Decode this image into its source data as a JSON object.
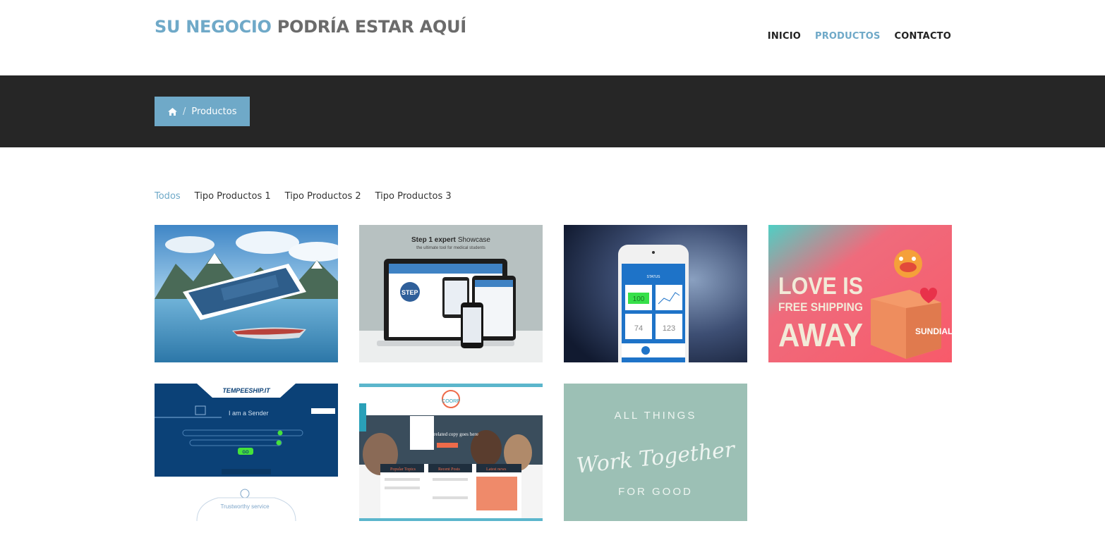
{
  "header": {
    "logo_accent": "SU NEGOCIO",
    "logo_rest": "PODRÍA ESTAR AQUÍ",
    "nav": [
      {
        "label": "INICIO",
        "active": false
      },
      {
        "label": "PRODUCTOS",
        "active": true
      },
      {
        "label": "CONTACTO",
        "active": false
      }
    ]
  },
  "breadcrumb": {
    "home_icon": "home-icon",
    "separator": "/",
    "current": "Productos"
  },
  "filters": [
    {
      "label": "Todos",
      "active": true
    },
    {
      "label": "Tipo Productos 1",
      "active": false
    },
    {
      "label": "Tipo Productos 2",
      "active": false
    },
    {
      "label": "Tipo Productos 3",
      "active": false
    }
  ],
  "portfolio": {
    "items": [
      {
        "kind": "landscape-website"
      },
      {
        "kind": "devices-showcase",
        "heading_strong": "Step 1 expert",
        "heading_rest": "Showcase",
        "subheading": "the ultimate tool for medical students",
        "brand": "STEP 1",
        "brand_sub": "EXPERT"
      },
      {
        "kind": "phone-app",
        "screen_title": "STATUS",
        "tiles": [
          "100",
          "74",
          "123"
        ]
      },
      {
        "kind": "love-poster",
        "lines": [
          "LOVE IS",
          "FREE SHIPPING",
          "AWAY"
        ],
        "brand": "SUNDIAL"
      },
      {
        "kind": "shipping-site",
        "brand": "TEMPEESHIP.IT",
        "headline": "I am a Sender",
        "button": "GO",
        "service": "Trustworthy service"
      },
      {
        "kind": "coorp-site",
        "brand": "COORP",
        "hero_text": "image related copy goes here",
        "sections": [
          "Popular Topics",
          "Recent Posts",
          "Latest news"
        ]
      },
      {
        "kind": "lettering",
        "top": "ALL THINGS",
        "middle": "Work Together",
        "bottom": "FOR GOOD"
      }
    ]
  },
  "colors": {
    "accent": "#6fa9c8",
    "banner": "#262626",
    "text": "#222222"
  }
}
